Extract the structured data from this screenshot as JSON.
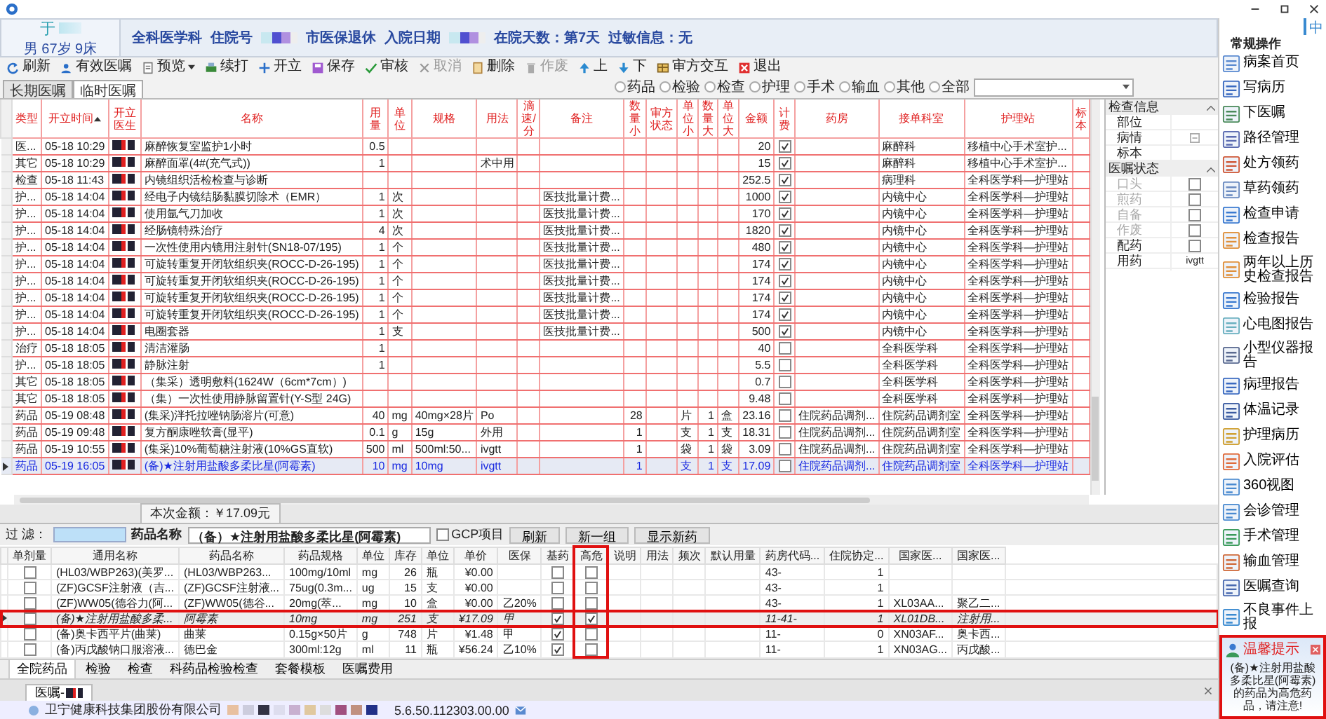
{
  "patient": {
    "name": "于",
    "summary": "男 67岁 9床"
  },
  "info": [
    {
      "kind": "text",
      "text": "全科医学科"
    },
    {
      "kind": "text",
      "text": "住院号"
    },
    {
      "kind": "redacted"
    },
    {
      "kind": "text",
      "text": "市医保退休"
    },
    {
      "kind": "text",
      "text": "入院日期"
    },
    {
      "kind": "redacted"
    },
    {
      "kind": "text",
      "text": "在院天数：第7天"
    },
    {
      "kind": "text",
      "text": "过敏信息：无"
    }
  ],
  "toolbar": [
    {
      "label": "刷新",
      "kind": "button",
      "disabled": false
    },
    {
      "label": "有效医嘱",
      "kind": "button",
      "disabled": false
    },
    {
      "label": "预览",
      "kind": "dropdown",
      "disabled": false
    },
    {
      "label": "续打",
      "kind": "button",
      "disabled": false
    },
    {
      "label": "开立",
      "kind": "button",
      "disabled": false
    },
    {
      "label": "保存",
      "kind": "button",
      "disabled": false
    },
    {
      "label": "审核",
      "kind": "button",
      "disabled": false
    },
    {
      "label": "取消",
      "kind": "button",
      "disabled": true
    },
    {
      "label": "删除",
      "kind": "button",
      "disabled": false
    },
    {
      "label": "作废",
      "kind": "button",
      "disabled": true
    },
    {
      "label": "上",
      "kind": "button",
      "disabled": false
    },
    {
      "label": "下",
      "kind": "button",
      "disabled": false
    },
    {
      "label": "审方交互",
      "kind": "button",
      "disabled": false
    },
    {
      "label": "退出",
      "kind": "button",
      "disabled": false
    }
  ],
  "tabs": [
    {
      "label": "长期医嘱",
      "selected": false
    },
    {
      "label": "临时医嘱",
      "selected": true
    }
  ],
  "filters": [
    {
      "label": "药品",
      "selected": false
    },
    {
      "label": "检验",
      "selected": false
    },
    {
      "label": "检查",
      "selected": false
    },
    {
      "label": "护理",
      "selected": false
    },
    {
      "label": "手术",
      "selected": false
    },
    {
      "label": "输血",
      "selected": false
    },
    {
      "label": "其他",
      "selected": false
    },
    {
      "label": "全部",
      "selected": false
    }
  ],
  "orders": {
    "columns": [
      {
        "label": "类型",
        "sorted": false
      },
      {
        "label": "开立时间",
        "sorted": true
      },
      {
        "label": "开立医生",
        "sorted": false
      },
      {
        "label": "名称",
        "sorted": false
      },
      {
        "label": "用量",
        "sorted": false
      },
      {
        "label": "单位",
        "sorted": false
      },
      {
        "label": "规格",
        "sorted": false
      },
      {
        "label": "用法",
        "sorted": false
      },
      {
        "label": "滴速/分",
        "sorted": false
      },
      {
        "label": "备注",
        "sorted": false
      },
      {
        "label": "数量小",
        "sorted": false
      },
      {
        "label": "审方状态",
        "sorted": false
      },
      {
        "label": "单位小",
        "sorted": false
      },
      {
        "label": "数量大",
        "sorted": false
      },
      {
        "label": "单位大",
        "sorted": false
      },
      {
        "label": "金额",
        "sorted": false
      },
      {
        "label": "计费",
        "sorted": false
      },
      {
        "label": "药房",
        "sorted": false
      },
      {
        "label": "接单科室",
        "sorted": false
      },
      {
        "label": "护理站",
        "sorted": false
      },
      {
        "label": "标本",
        "sorted": false
      }
    ],
    "rows": [
      {
        "type": "医...",
        "time": "05-18 10:29",
        "name": "麻醉恢复室监护1小时",
        "dose": "0.5",
        "amount": "20",
        "billed": true,
        "dept": "麻醉科",
        "station": "移植中心手术室护...",
        "selected": false
      },
      {
        "type": "其它",
        "time": "05-18 10:29",
        "name": "麻醉面罩(4#(充气式))",
        "dose": "1",
        "usage": "术中用",
        "amount": "15",
        "billed": true,
        "dept": "麻醉科",
        "station": "移植中心手术室护...",
        "selected": false
      },
      {
        "type": "检查",
        "time": "05-18 11:43",
        "name": "内镜组织活检检查与诊断",
        "amount": "252.5",
        "billed": true,
        "dept": "病理科",
        "station": "全科医学科—护理站",
        "selected": false
      },
      {
        "type": "护...",
        "time": "05-18 14:04",
        "name": "经电子内镜结肠黏膜切除术（EMR）",
        "dose": "1",
        "unit": "次",
        "note": "医技批量计费...",
        "amount": "1000",
        "billed": true,
        "dept": "内镜中心",
        "station": "全科医学科—护理站",
        "selected": false
      },
      {
        "type": "护...",
        "time": "05-18 14:04",
        "name": "使用氩气刀加收",
        "dose": "1",
        "unit": "次",
        "note": "医技批量计费...",
        "amount": "170",
        "billed": true,
        "dept": "内镜中心",
        "station": "全科医学科—护理站",
        "selected": false
      },
      {
        "type": "护...",
        "time": "05-18 14:04",
        "name": "经肠镜特殊治疗",
        "dose": "4",
        "unit": "次",
        "note": "医技批量计费...",
        "amount": "1820",
        "billed": true,
        "dept": "内镜中心",
        "station": "全科医学科—护理站",
        "selected": false
      },
      {
        "type": "护...",
        "time": "05-18 14:04",
        "name": "一次性使用内镜用注射针(SN18-07/195)",
        "dose": "1",
        "unit": "个",
        "note": "医技批量计费...",
        "amount": "480",
        "billed": true,
        "dept": "内镜中心",
        "station": "全科医学科—护理站",
        "selected": false
      },
      {
        "type": "护...",
        "time": "05-18 14:04",
        "name": "可旋转重复开闭软组织夹(ROCC-D-26-195)",
        "dose": "1",
        "unit": "个",
        "note": "医技批量计费...",
        "amount": "174",
        "billed": true,
        "dept": "内镜中心",
        "station": "全科医学科—护理站",
        "selected": false
      },
      {
        "type": "护...",
        "time": "05-18 14:04",
        "name": "可旋转重复开闭软组织夹(ROCC-D-26-195)",
        "dose": "1",
        "unit": "个",
        "note": "医技批量计费...",
        "amount": "174",
        "billed": true,
        "dept": "内镜中心",
        "station": "全科医学科—护理站",
        "selected": false
      },
      {
        "type": "护...",
        "time": "05-18 14:04",
        "name": "可旋转重复开闭软组织夹(ROCC-D-26-195)",
        "dose": "1",
        "unit": "个",
        "note": "医技批量计费...",
        "amount": "174",
        "billed": true,
        "dept": "内镜中心",
        "station": "全科医学科—护理站",
        "selected": false
      },
      {
        "type": "护...",
        "time": "05-18 14:04",
        "name": "可旋转重复开闭软组织夹(ROCC-D-26-195)",
        "dose": "1",
        "unit": "个",
        "note": "医技批量计费...",
        "amount": "174",
        "billed": true,
        "dept": "内镜中心",
        "station": "全科医学科—护理站",
        "selected": false
      },
      {
        "type": "护...",
        "time": "05-18 14:04",
        "name": "电圈套器",
        "dose": "1",
        "unit": "支",
        "note": "医技批量计费...",
        "amount": "500",
        "billed": true,
        "dept": "内镜中心",
        "station": "全科医学科—护理站",
        "selected": false
      },
      {
        "type": "治疗",
        "time": "05-18 18:05",
        "name": "清洁灌肠",
        "dose": "1",
        "amount": "40",
        "billed": false,
        "dept": "全科医学科",
        "station": "全科医学科—护理站",
        "selected": false
      },
      {
        "type": "护...",
        "time": "05-18 18:05",
        "name": "静脉注射",
        "dose": "1",
        "amount": "5.5",
        "billed": false,
        "dept": "全科医学科",
        "station": "全科医学科—护理站",
        "selected": false
      },
      {
        "type": "其它",
        "time": "05-18 18:05",
        "name": "（集采）透明敷料(1624W（6cm*7cm）)",
        "amount": "0.7",
        "billed": false,
        "dept": "全科医学科",
        "station": "全科医学科—护理站",
        "selected": false
      },
      {
        "type": "其它",
        "time": "05-18 18:05",
        "name": "（集）一次性使用静脉留置针(Y-S型 24G)",
        "amount": "9.48",
        "billed": false,
        "dept": "全科医学科",
        "station": "全科医学科—护理站",
        "selected": false
      },
      {
        "type": "药品",
        "time": "05-19 08:48",
        "name": "(集采)泮托拉唑钠肠溶片(可意)",
        "dose": "40",
        "unit": "mg",
        "spec": "40mg×28片",
        "usage": "Po",
        "qty_small": "28",
        "unit_small": "片",
        "qty_big": "1",
        "unit_big": "盒",
        "amount": "23.16",
        "billed": false,
        "pharmacy": "住院药品调剂...",
        "dept": "住院药品调剂室",
        "station": "全科医学科—护理站",
        "selected": false
      },
      {
        "type": "药品",
        "time": "05-19 09:48",
        "name": "复方酮康唑软膏(显平)",
        "dose": "0.1",
        "unit": "g",
        "spec": "15g",
        "usage": "外用",
        "qty_small": "1",
        "unit_small": "支",
        "qty_big": "1",
        "unit_big": "支",
        "amount": "18.31",
        "billed": false,
        "pharmacy": "住院药品调剂...",
        "dept": "住院药品调剂室",
        "station": "全科医学科—护理站",
        "selected": false
      },
      {
        "type": "药品",
        "time": "05-19 10:55",
        "name": "(集采)10%葡萄糖注射液(10%GS直软)",
        "dose": "500",
        "unit": "ml",
        "spec": "500ml:50...",
        "usage": "ivgtt",
        "qty_small": "1",
        "unit_small": "袋",
        "qty_big": "1",
        "unit_big": "袋",
        "amount": "3.09",
        "billed": false,
        "pharmacy": "住院药品调剂...",
        "dept": "住院药品调剂室",
        "station": "全科医学科—护理站",
        "selected": false
      },
      {
        "type": "药品",
        "time": "05-19 16:05",
        "name": "(备)★注射用盐酸多柔比星(阿霉素)",
        "dose": "10",
        "unit": "mg",
        "spec": "10mg",
        "usage": "ivgtt",
        "qty_small": "1",
        "unit_small": "支",
        "qty_big": "1",
        "unit_big": "支",
        "amount": "17.09",
        "billed": false,
        "pharmacy": "住院药品调剂...",
        "dept": "住院药品调剂室",
        "station": "全科医学科—护理站",
        "selected": true
      }
    ],
    "total": "本次金额：￥17.09元"
  },
  "inspection": {
    "sections": [
      {
        "title": "检查信息",
        "expanded": true,
        "items": [
          {
            "label": "部位",
            "kind": "text",
            "disabled": false
          },
          {
            "label": "病情",
            "kind": "picker",
            "disabled": false
          },
          {
            "label": "标本",
            "kind": "text",
            "disabled": false
          }
        ]
      },
      {
        "title": "医嘱状态",
        "expanded": true,
        "items": [
          {
            "label": "口头",
            "kind": "checkbox",
            "checked": false,
            "disabled": true
          },
          {
            "label": "煎药",
            "kind": "checkbox",
            "checked": false,
            "disabled": true
          },
          {
            "label": "自备",
            "kind": "checkbox",
            "checked": false,
            "disabled": true
          },
          {
            "label": "作废",
            "kind": "checkbox",
            "checked": false,
            "disabled": true
          },
          {
            "label": "配药",
            "kind": "checkbox",
            "checked": false,
            "disabled": false
          },
          {
            "label": "用药",
            "kind": "text",
            "value": "ivgtt",
            "disabled": false
          }
        ]
      }
    ]
  },
  "drug_search": {
    "filter_label": "过 滤：",
    "name_label": "药品名称",
    "name_value": "（备）★注射用盐酸多柔比星(阿霉素)",
    "gcp": {
      "label": "GCP项目",
      "checked": false
    },
    "buttons": [
      "刷新",
      "新一组",
      "显示新药"
    ]
  },
  "drugs": {
    "columns": [
      {
        "label": "单剂量",
        "highlighted": false
      },
      {
        "label": "通用名称",
        "highlighted": false
      },
      {
        "label": "药品名称",
        "highlighted": false
      },
      {
        "label": "药品规格",
        "highlighted": false
      },
      {
        "label": "单位",
        "highlighted": false
      },
      {
        "label": "库存",
        "highlighted": false
      },
      {
        "label": "单位",
        "highlighted": false
      },
      {
        "label": "单价",
        "highlighted": false
      },
      {
        "label": "医保",
        "highlighted": false
      },
      {
        "label": "基药",
        "highlighted": false
      },
      {
        "label": "高危",
        "highlighted": true
      },
      {
        "label": "说明",
        "highlighted": false
      },
      {
        "label": "用法",
        "highlighted": false
      },
      {
        "label": "频次",
        "highlighted": false
      },
      {
        "label": "默认用量",
        "highlighted": false
      },
      {
        "label": "药房代码...",
        "highlighted": false
      },
      {
        "label": "住院协定...",
        "highlighted": false
      },
      {
        "label": "国家医...",
        "highlighted": false
      },
      {
        "label": "国家医...",
        "highlighted": false
      }
    ],
    "rows": [
      {
        "single": false,
        "generic": "(HL03/WBP263)(美罗...",
        "brand": "(HL03/WBP263...",
        "spec": "100mg/10ml",
        "unit": "mg",
        "stock": "26",
        "pack_unit": "瓶",
        "price": "¥0.00",
        "essential": false,
        "high_risk": false,
        "code": "43-",
        "agreement": "1",
        "selected": false
      },
      {
        "single": false,
        "generic": "(ZF)GCSF注射液（吉...",
        "brand": "(ZF)GCSF注射液...",
        "spec": "75ug(0.3m...",
        "unit": "ug",
        "stock": "15",
        "pack_unit": "支",
        "price": "¥0.00",
        "essential": false,
        "high_risk": false,
        "code": "43-",
        "agreement": "1",
        "selected": false
      },
      {
        "single": false,
        "generic": "(ZF)WW05(德谷力(阿...",
        "brand": "(ZF)WW05(德谷...",
        "spec": "20mg(萃...",
        "unit": "mg",
        "stock": "10",
        "pack_unit": "盒",
        "price": "¥0.00",
        "insurance": "乙20%",
        "essential": false,
        "high_risk": false,
        "code": "43-",
        "agreement": "1",
        "national_code": "XL03AA...",
        "national_name": "聚乙二...",
        "selected": false
      },
      {
        "single": false,
        "generic": "(备)★注射用盐酸多柔...",
        "brand": "阿霉素",
        "spec": "10mg",
        "unit": "mg",
        "stock": "251",
        "pack_unit": "支",
        "price": "¥17.09",
        "insurance": "甲",
        "essential": true,
        "high_risk": true,
        "code": "11-41-",
        "agreement": "1",
        "national_code": "XL01DB...",
        "national_name": "注射用...",
        "selected": true
      },
      {
        "single": false,
        "generic": "(备)奥卡西平片(曲莱)",
        "brand": "曲莱",
        "spec": "0.15g×50片",
        "unit": "g",
        "stock": "748",
        "pack_unit": "片",
        "price": "¥1.48",
        "insurance": "甲",
        "essential": true,
        "high_risk": false,
        "code": "11-",
        "agreement": "0",
        "national_code": "XN03AF...",
        "national_name": "奥卡西...",
        "selected": false
      },
      {
        "single": false,
        "generic": "(备)丙戊酸钠口服溶液...",
        "brand": "德巴金",
        "spec": "300ml:12g",
        "unit": "ml",
        "stock": "11",
        "pack_unit": "瓶",
        "price": "¥56.24",
        "insurance": "乙10%",
        "essential": true,
        "high_risk": false,
        "code": "11-",
        "agreement": "1",
        "national_code": "XN03AG...",
        "national_name": "丙戊酸...",
        "selected": false
      }
    ]
  },
  "bottom_tabs": [
    {
      "label": "全院药品",
      "selected": true
    },
    {
      "label": "检验",
      "selected": false
    },
    {
      "label": "检查",
      "selected": false
    },
    {
      "label": "科药品检验检查",
      "selected": false
    },
    {
      "label": "套餐模板",
      "selected": false
    },
    {
      "label": "医嘱费用",
      "selected": false
    }
  ],
  "document_tab": {
    "label": "医嘱-"
  },
  "status_bar": {
    "company": "卫宁健康科技集团股份有限公司",
    "version": "5.6.50.112303.00.00"
  },
  "sidebar": {
    "tab": "中",
    "heading": "常规操作",
    "items": [
      "病案首页",
      "写病历",
      "下医嘱",
      "路径管理",
      "处方领药",
      "草药领药",
      "检查申请",
      "检查报告",
      "两年以上历史检查报告",
      "检验报告",
      "心电图报告",
      "小型仪器报告",
      "病理报告",
      "体温记录",
      "护理病历",
      "入院评估",
      "360视图",
      "会诊管理",
      "手术管理",
      "输血管理",
      "医嘱查询",
      "不良事件上报"
    ]
  },
  "alert": {
    "title": "温馨提示",
    "message": "(备)★注射用盐酸多柔比星(阿霉素) 的药品为高危药品，请注意!"
  }
}
